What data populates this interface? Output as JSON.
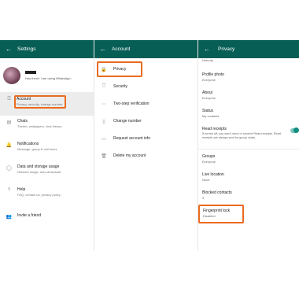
{
  "settings": {
    "title": "Settings",
    "profile_status": "Hey there! I am using WhatsApp.",
    "items": [
      {
        "icon": "key-icon",
        "glyph": "⚿",
        "title": "Account",
        "subtitle": "Privacy, security, change number"
      },
      {
        "icon": "chat-icon",
        "glyph": "▤",
        "title": "Chats",
        "subtitle": "Theme, wallpapers, chat history"
      },
      {
        "icon": "bell-icon",
        "glyph": "🔔",
        "title": "Notifications",
        "subtitle": "Message, group & call tones"
      },
      {
        "icon": "data-usage-icon",
        "glyph": "◯",
        "title": "Data and storage usage",
        "subtitle": "Network usage, auto-download"
      },
      {
        "icon": "help-icon",
        "glyph": "?",
        "title": "Help",
        "subtitle": "FAQ, contact us, privacy policy"
      },
      {
        "icon": "people-icon",
        "glyph": "👥",
        "title": "Invite a friend",
        "subtitle": ""
      }
    ]
  },
  "account": {
    "title": "Account",
    "items": [
      {
        "icon": "lock-icon",
        "glyph": "🔒",
        "label": "Privacy"
      },
      {
        "icon": "shield-icon",
        "glyph": "⛉",
        "label": "Security"
      },
      {
        "icon": "dots-icon",
        "glyph": "⋯",
        "label": "Two-step verification"
      },
      {
        "icon": "phone-swap-icon",
        "glyph": "▯",
        "label": "Change number"
      },
      {
        "icon": "document-icon",
        "glyph": "▭",
        "label": "Request account info"
      },
      {
        "icon": "trash-icon",
        "glyph": "🗑",
        "label": "Delete my account"
      }
    ]
  },
  "privacy": {
    "title": "Privacy",
    "last_seen_value": "Nobody",
    "profile_photo": {
      "label": "Profile photo",
      "value": "Everyone"
    },
    "about": {
      "label": "About",
      "value": "Everyone"
    },
    "status": {
      "label": "Status",
      "value": "My contacts"
    },
    "read_receipts": {
      "label": "Read receipts",
      "desc": "If turned off, you won't send or receive Read receipts. Read receipts are always sent for group chats.",
      "enabled": true
    },
    "groups": {
      "label": "Groups",
      "value": "Everyone"
    },
    "live_location": {
      "label": "Live location",
      "value": "None"
    },
    "blocked": {
      "label": "Blocked contacts",
      "value": "3"
    },
    "fingerprint": {
      "label": "Fingerprint lock",
      "value": "Disabled"
    }
  },
  "colors": {
    "appbar": "#075e54",
    "highlight": "#ea6b1f",
    "toggle": "#0f8f7f"
  }
}
